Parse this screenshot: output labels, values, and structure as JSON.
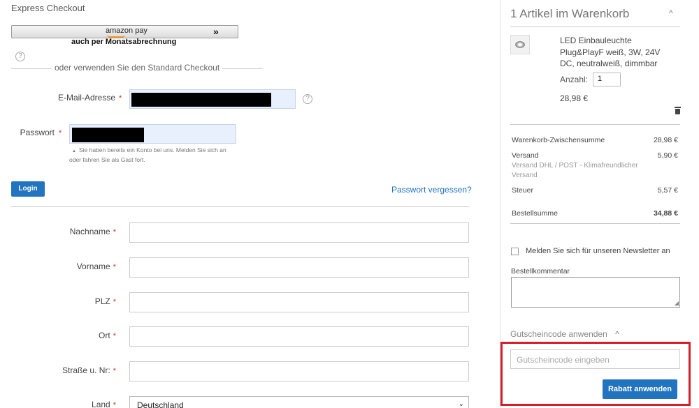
{
  "express": {
    "title": "Express Checkout",
    "amazon_brand": "amazon pay",
    "amazon_chevrons": "»",
    "amazon_sub": "auch per Monatsabrechnung",
    "help_glyph": "?"
  },
  "divider": {
    "text": "oder verwenden Sie den Standard Checkout"
  },
  "login": {
    "email_label": "E-Mail-Adresse",
    "password_label": "Passwort",
    "required_mark": "*",
    "hint": "Sie haben bereits ein Konto bei uns. Melden Sie sich an oder fahren Sie als Gast fort.",
    "hint_arrow": "▲",
    "login_button": "Login",
    "forgot_link": "Passwort vergessen?"
  },
  "form": {
    "fields": [
      {
        "label": "Nachname",
        "value": ""
      },
      {
        "label": "Vorname",
        "value": ""
      },
      {
        "label": "PLZ",
        "value": ""
      },
      {
        "label": "Ort",
        "value": ""
      },
      {
        "label": "Straße u. Nr:",
        "value": ""
      }
    ],
    "country_label": "Land",
    "country_value": "Deutschland",
    "select_arrow": "⌄"
  },
  "cart": {
    "title": "1 Artikel im Warenkorb",
    "collapse_glyph": "^",
    "product_name": "LED Einbauleuchte Plug&PlayF weiß, 3W, 24V DC, neutralweiß, dimmbar",
    "qty_label": "Anzahl:",
    "qty_value": "1",
    "price": "28,98 €",
    "subtotal_label": "Warenkorb-Zwischensumme",
    "subtotal_value": "28,98 €",
    "shipping_label": "Versand",
    "shipping_value": "5,90 €",
    "shipping_method": "Versand DHL / POST - Klimafreundlicher Versand",
    "tax_label": "Steuer",
    "tax_value": "5,57 €",
    "total_label": "Bestellsumme",
    "total_value": "34,88 €",
    "newsletter_label": "Melden Sie sich für unseren Newsletter an",
    "comment_label": "Bestellkommentar",
    "coupon_toggle": "Gutscheincode anwenden",
    "coupon_caret": "^",
    "coupon_placeholder": "Gutscheincode eingeben",
    "apply_button": "Rabatt anwenden",
    "resize_grip": "◢"
  },
  "colors": {
    "accent": "#2273c0",
    "highlight": "#d4202a",
    "required": "#c0392b"
  }
}
